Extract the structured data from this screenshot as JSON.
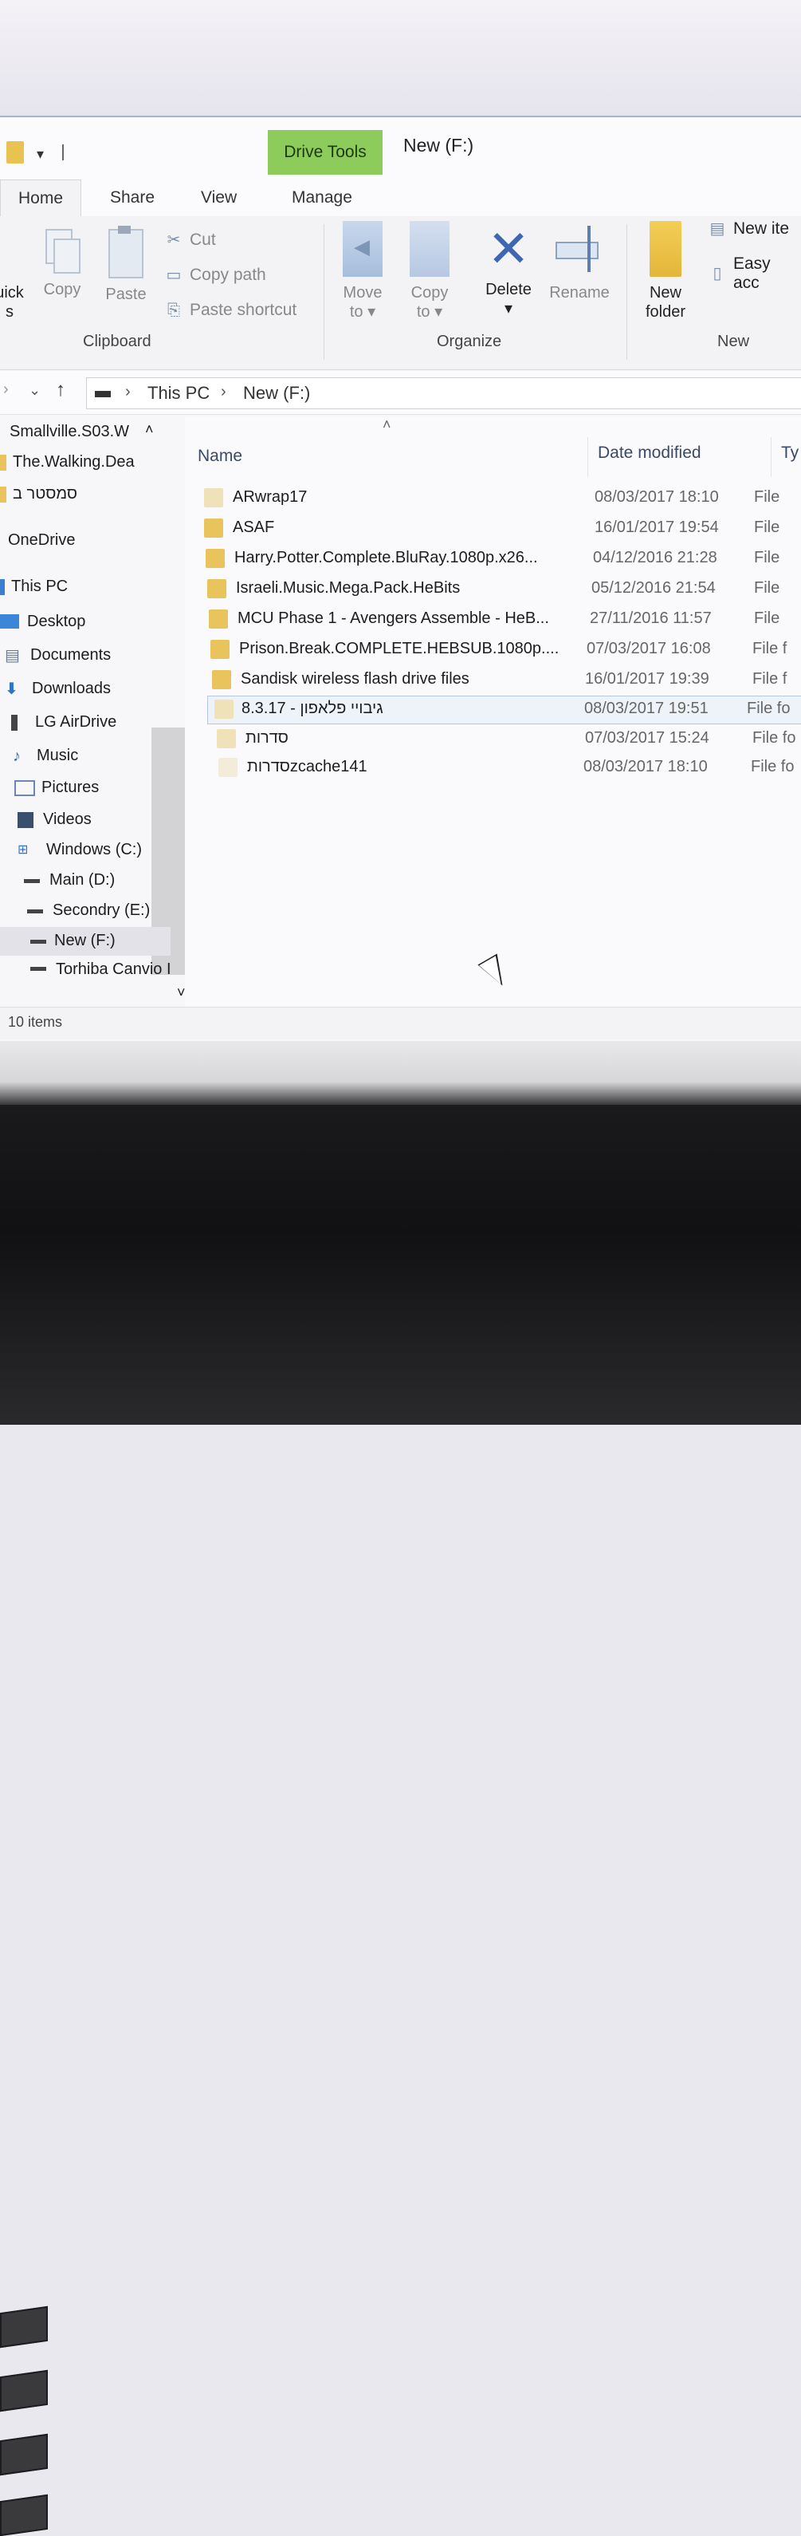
{
  "window": {
    "title": "New (F:)",
    "context_tab": "Drive Tools"
  },
  "tabs": [
    "Home",
    "Share",
    "View",
    "Manage"
  ],
  "ribbon": {
    "clipboard": {
      "label": "Clipboard",
      "pin_partial_top": "uick",
      "pin_partial_bottom": "s",
      "copy": "Copy",
      "paste": "Paste",
      "cut": "Cut",
      "copy_path": "Copy path",
      "paste_shortcut": "Paste shortcut"
    },
    "organize": {
      "label": "Organize",
      "move_to_1": "Move",
      "move_to_2": "to",
      "copy_to_1": "Copy",
      "copy_to_2": "to",
      "delete": "Delete",
      "rename": "Rename"
    },
    "new": {
      "label": "New",
      "new_folder_1": "New",
      "new_folder_2": "folder",
      "new_item": "New ite",
      "easy_access": "Easy acc"
    }
  },
  "address": {
    "crumbs": [
      "This PC",
      "New (F:)"
    ]
  },
  "nav": {
    "items": [
      {
        "label": "Smallville.S03.W",
        "icon": "folder-icon"
      },
      {
        "label": "The.Walking.Dea",
        "icon": "folder-icon"
      },
      {
        "label": "סמסטר ב",
        "icon": "folder-icon"
      },
      {
        "label": "OneDrive",
        "icon": "cloud-icon"
      },
      {
        "label": "This PC",
        "icon": "computer-icon"
      },
      {
        "label": "Desktop",
        "icon": "desktop-icon"
      },
      {
        "label": "Documents",
        "icon": "documents-icon"
      },
      {
        "label": "Downloads",
        "icon": "download-icon"
      },
      {
        "label": "LG AirDrive",
        "icon": "drive-icon"
      },
      {
        "label": "Music",
        "icon": "music-icon"
      },
      {
        "label": "Pictures",
        "icon": "pictures-icon"
      },
      {
        "label": "Videos",
        "icon": "videos-icon"
      },
      {
        "label": "Windows (C:)",
        "icon": "windows-drive-icon"
      },
      {
        "label": "Main (D:)",
        "icon": "drive-icon"
      },
      {
        "label": "Secondry (E:)",
        "icon": "drive-icon"
      },
      {
        "label": "New (F:)",
        "icon": "drive-icon"
      },
      {
        "label": "Torhiba Canvio I",
        "icon": "drive-icon"
      }
    ]
  },
  "list": {
    "columns": [
      "Name",
      "Date modified",
      "Ty"
    ],
    "rows": [
      {
        "name": "ARwrap17",
        "date": "08/03/2017 18:10",
        "type": "File"
      },
      {
        "name": "ASAF",
        "date": "16/01/2017 19:54",
        "type": "File"
      },
      {
        "name": "Harry.Potter.Complete.BluRay.1080p.x26...",
        "date": "04/12/2016 21:28",
        "type": "File"
      },
      {
        "name": "Israeli.Music.Mega.Pack.HeBits",
        "date": "05/12/2016 21:54",
        "type": "File"
      },
      {
        "name": "MCU Phase 1 - Avengers Assemble - HeB...",
        "date": "27/11/2016 11:57",
        "type": "File"
      },
      {
        "name": "Prison.Break.COMPLETE.HEBSUB.1080p....",
        "date": "07/03/2017 16:08",
        "type": "File f"
      },
      {
        "name": "Sandisk wireless flash drive files",
        "date": "16/01/2017 19:39",
        "type": "File f"
      },
      {
        "name": "גיבויי פלאפון - 8.3.17",
        "date": "08/03/2017 19:51",
        "type": "File fo"
      },
      {
        "name": "סדרות",
        "date": "07/03/2017 15:24",
        "type": "File fo"
      },
      {
        "name": "סדרותzcache141",
        "date": "08/03/2017 18:10",
        "type": "File fo"
      }
    ]
  },
  "status": {
    "count": "10 items"
  },
  "colors": {
    "context_tab": "#8dcc5a",
    "folder": "#e9c35c",
    "delete_icon": "#3f66b0"
  }
}
